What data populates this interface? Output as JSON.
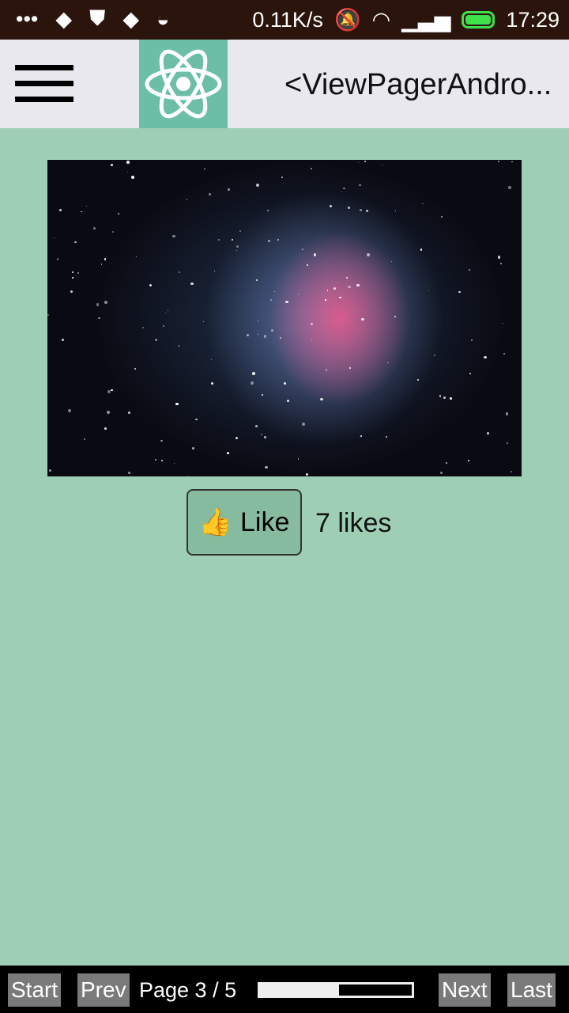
{
  "status_bar": {
    "left_icons": [
      "more-dots-icon",
      "notification-icon",
      "shield-alert-icon",
      "notification-icon",
      "android-icon"
    ],
    "network_speed": "0.11K/s",
    "time": "17:29",
    "battery_color": "#3fe04a"
  },
  "app_bar": {
    "title": "<ViewPagerAndro...",
    "menu_icon": "hamburger-menu-icon",
    "logo_icon": "react-atom-icon"
  },
  "content": {
    "image": "nebula-photo",
    "like_emoji": "👍",
    "like_label": "Like",
    "likes_text": "7 likes"
  },
  "pager": {
    "start": "Start",
    "prev": "Prev",
    "page_text": "Page 3 / 5",
    "progress": 0.52,
    "next": "Next",
    "last": "Last"
  },
  "colors": {
    "background": "#9ecfb5",
    "app_bar": "#e8e8ee",
    "logo_bg": "#6cbfa6",
    "status_bar": "#2b140c"
  }
}
